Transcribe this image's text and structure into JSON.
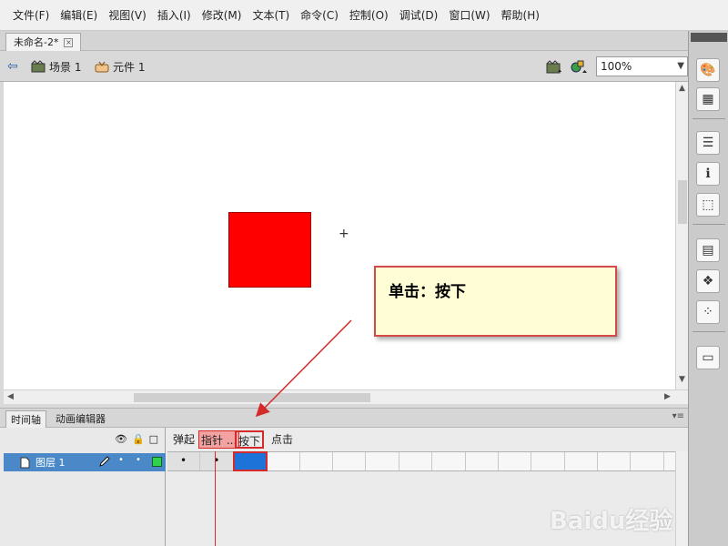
{
  "menubar": {
    "items": [
      "文件(F)",
      "编辑(E)",
      "视图(V)",
      "插入(I)",
      "修改(M)",
      "文本(T)",
      "命令(C)",
      "控制(O)",
      "调试(D)",
      "窗口(W)",
      "帮助(H)"
    ]
  },
  "document_tab": {
    "title": "未命名-2*",
    "close": "×"
  },
  "edit_bar": {
    "back_glyph": "⇦",
    "scene_label": "场景 1",
    "symbol_label": "元件 1",
    "zoom_value": "100%"
  },
  "stage": {
    "crosshair": "+"
  },
  "callout": {
    "text": "单击：按下"
  },
  "timeline": {
    "tabs": [
      "时间轴",
      "动画编辑器"
    ],
    "panel_menu": "▾≡",
    "header_icons": [
      "👁",
      "🔒",
      "□"
    ],
    "layer_name": "图层 1",
    "frame_labels": [
      "弹起",
      "指针 ...",
      "按下",
      "点击"
    ]
  },
  "watermark": "Baidu经验",
  "colors": {
    "accent_red": "#d42a2a",
    "selected_frame": "#1e73d8",
    "layer_row": "#4a88c8",
    "callout_bg": "#fffdd5",
    "square_fill": "#ff0000"
  }
}
